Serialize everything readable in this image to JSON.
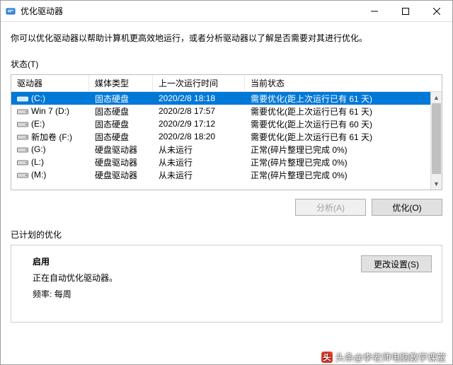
{
  "window": {
    "title": "优化驱动器"
  },
  "description": "你可以优化驱动器以帮助计算机更高效地运行，或者分析驱动器以了解是否需要对其进行优化。",
  "status_label": "状态(T)",
  "columns": {
    "drive": "驱动器",
    "media": "媒体类型",
    "last_run": "上一次运行时间",
    "current": "当前状态"
  },
  "drives": [
    {
      "name": "(C:)",
      "media": "固态硬盘",
      "last": "2020/2/8 18:18",
      "status": "需要优化(距上次运行已有 61 天)",
      "selected": true,
      "icon": "ssd"
    },
    {
      "name": "Win 7 (D:)",
      "media": "固态硬盘",
      "last": "2020/2/8 17:57",
      "status": "需要优化(距上次运行已有 61 天)",
      "icon": "hdd"
    },
    {
      "name": "(E:)",
      "media": "固态硬盘",
      "last": "2020/2/9 17:12",
      "status": "需要优化(距上次运行已有 60 天)",
      "icon": "hdd"
    },
    {
      "name": "新加卷 (F:)",
      "media": "固态硬盘",
      "last": "2020/2/8 18:20",
      "status": "需要优化(距上次运行已有 61 天)",
      "icon": "hdd"
    },
    {
      "name": "(G:)",
      "media": "硬盘驱动器",
      "last": "从未运行",
      "status": "正常(碎片整理已完成 0%)",
      "icon": "hdd"
    },
    {
      "name": "(L:)",
      "media": "硬盘驱动器",
      "last": "从未运行",
      "status": "正常(碎片整理已完成 0%)",
      "icon": "hdd"
    },
    {
      "name": "(M:)",
      "media": "硬盘驱动器",
      "last": "从未运行",
      "status": "正常(碎片整理已完成 0%)",
      "icon": "hdd"
    }
  ],
  "buttons": {
    "analyze": "分析(A)",
    "optimize": "优化(O)",
    "change_settings": "更改设置(S)"
  },
  "scheduled": {
    "section_label": "已计划的优化",
    "enabled_title": "启用",
    "enabled_desc": "正在自动优化驱动器。",
    "freq_label": "频率:",
    "freq_value": "每周"
  },
  "watermark": "头条@李老师电脑教学课堂"
}
